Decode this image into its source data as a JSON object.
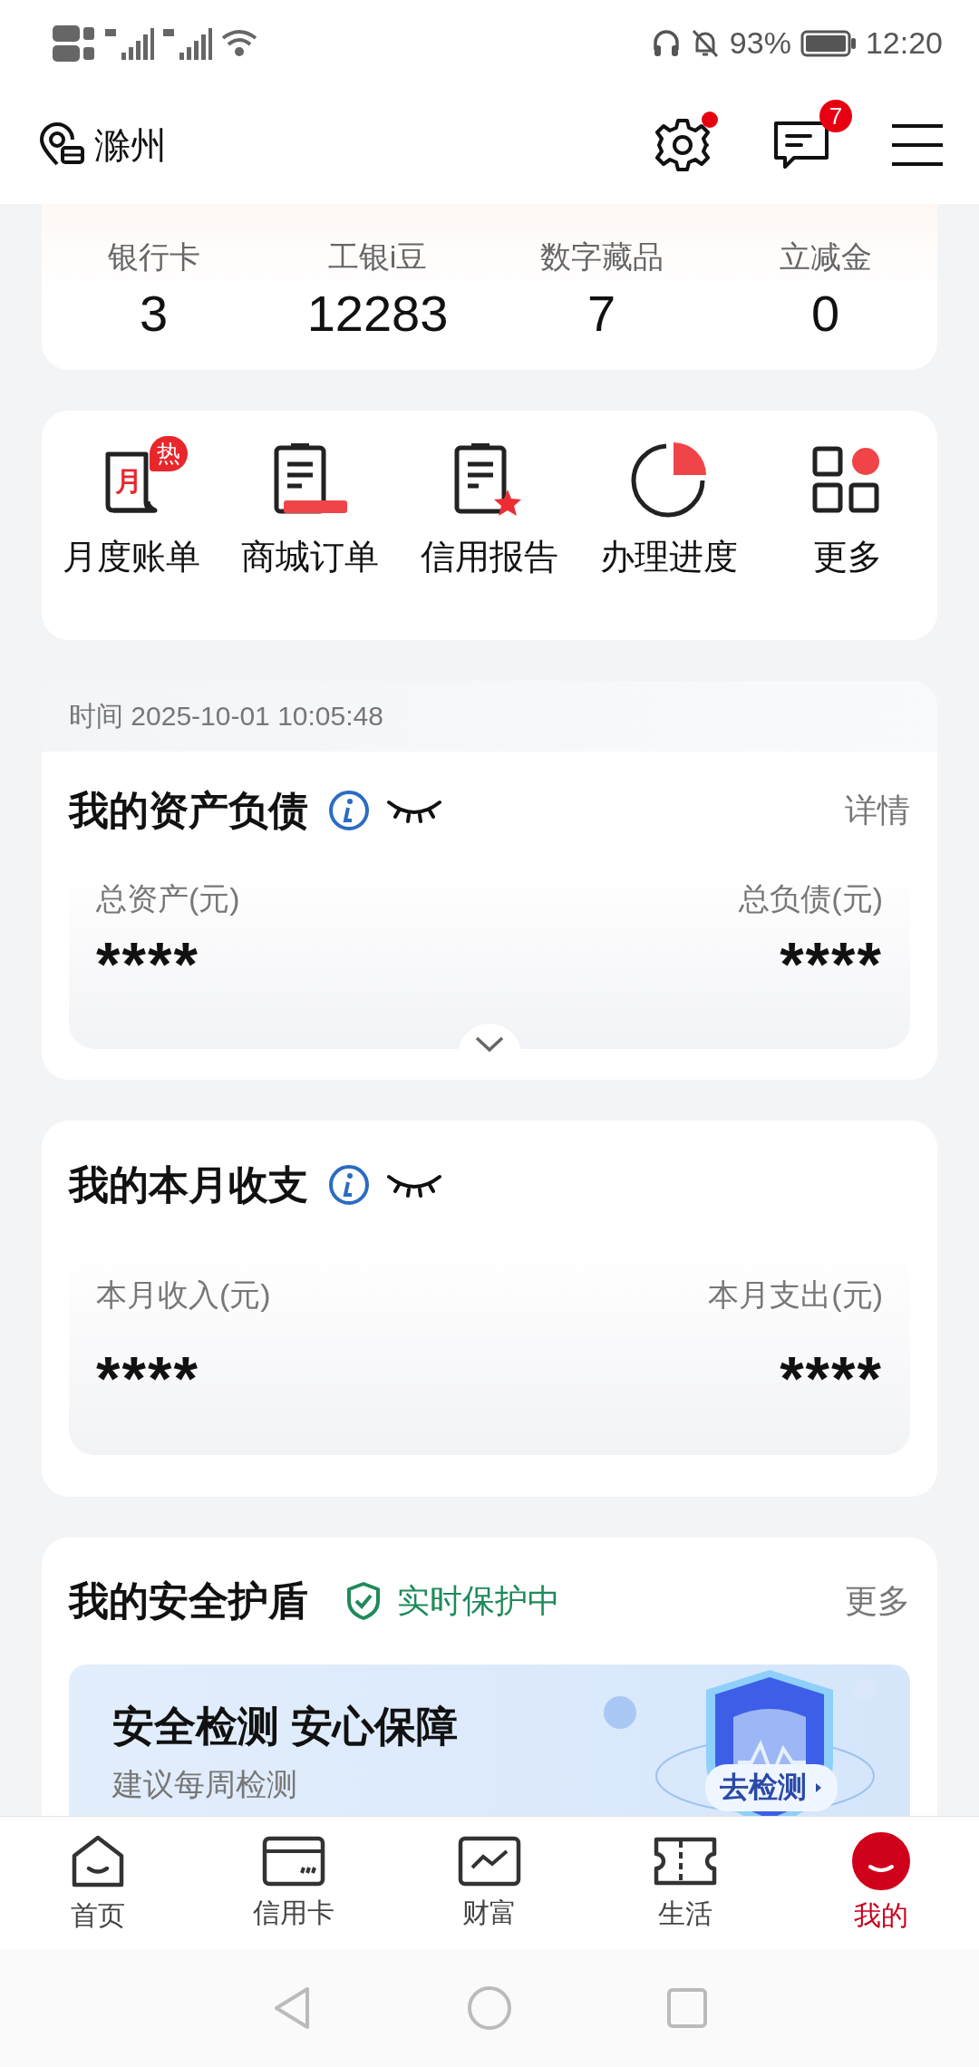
{
  "status_bar": {
    "battery": "93%",
    "time": "12:20"
  },
  "header": {
    "location": "滁州",
    "settings_dot": true,
    "message_badge": "7"
  },
  "stats": [
    {
      "label": "银行卡",
      "value": "3"
    },
    {
      "label": "工银i豆",
      "value": "12283"
    },
    {
      "label": "数字藏品",
      "value": "7"
    },
    {
      "label": "立减金",
      "value": "0"
    }
  ],
  "shortcuts": [
    {
      "kind": "bill",
      "label": "月度账单",
      "badge": "热",
      "glyph": "月"
    },
    {
      "kind": "order",
      "label": "商城订单"
    },
    {
      "kind": "report",
      "label": "信用报告"
    },
    {
      "kind": "progress",
      "label": "办理进度"
    },
    {
      "kind": "more",
      "label": "更多"
    }
  ],
  "assets": {
    "timestamp": "时间 2025-10-01 10:05:48",
    "title": "我的资产负债",
    "amounts_hidden": true,
    "detail_link": "详情",
    "items": [
      {
        "label": "总资产(元)",
        "value": "****"
      },
      {
        "label": "总负债(元)",
        "value": "****"
      }
    ]
  },
  "income": {
    "title": "我的本月收支",
    "amounts_hidden": true,
    "items": [
      {
        "label": "本月收入(元)",
        "value": "****"
      },
      {
        "label": "本月支出(元)",
        "value": "****"
      }
    ]
  },
  "security": {
    "title": "我的安全护盾",
    "status": "实时保护中",
    "more_link": "更多",
    "banner": {
      "title": "安全检测 安心保障",
      "subtitle": "建议每周检测",
      "button": "去检测"
    }
  },
  "tabs": [
    {
      "kind": "home",
      "label": "首页",
      "selected": false
    },
    {
      "kind": "card",
      "label": "信用卡",
      "selected": false
    },
    {
      "kind": "wealth",
      "label": "财富",
      "selected": false
    },
    {
      "kind": "life",
      "label": "生活",
      "selected": false
    },
    {
      "kind": "mine",
      "label": "我的",
      "selected": true
    }
  ]
}
